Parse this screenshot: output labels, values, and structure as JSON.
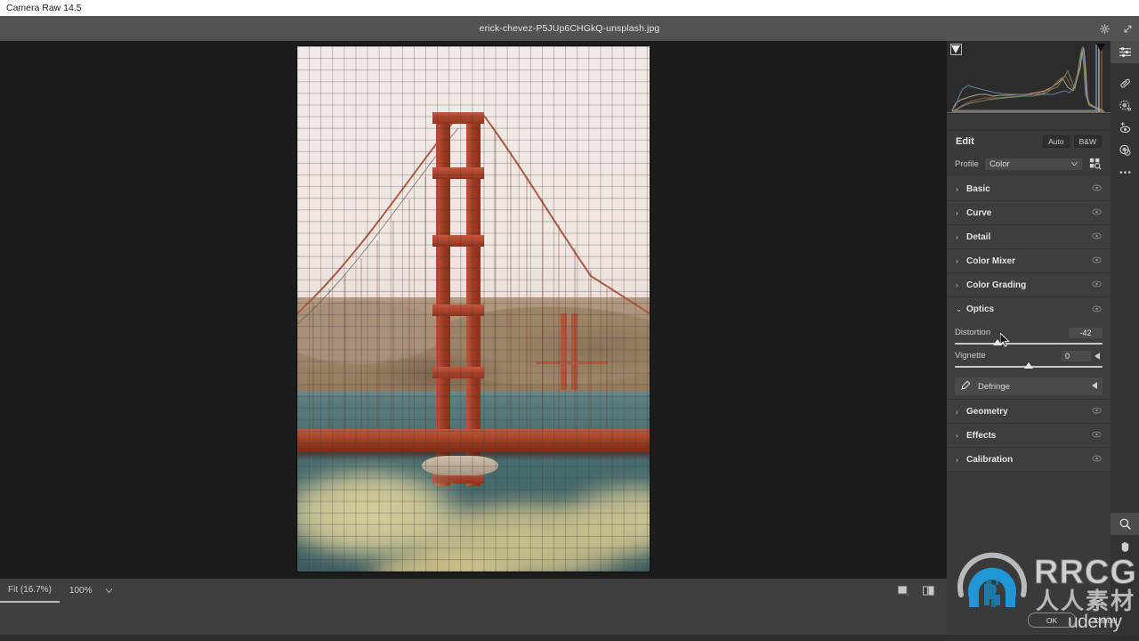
{
  "window": {
    "title": "Camera Raw 14.5"
  },
  "header": {
    "filename": "erick-chevez-P5JUp6CHGkQ-unsplash.jpg",
    "settings_icon": "gear-icon",
    "fullscreen_icon": "expand-icon"
  },
  "canvas": {
    "image_alt": "Golden Gate Bridge",
    "grid_overlay": true
  },
  "statusbar": {
    "fit_label": "Fit (16.7%)",
    "zoom_label": "100%",
    "zoom_caret": "⌄",
    "view_single_icon": "single-view-icon",
    "view_before_after_icon": "before-after-view-icon"
  },
  "panel": {
    "edit": {
      "title": "Edit",
      "auto_label": "Auto",
      "bw_label": "B&W"
    },
    "profile": {
      "label": "Profile",
      "value": "Color",
      "caret": "⌄",
      "browse_icon": "browse-profiles-icon"
    },
    "sections": [
      {
        "name": "Basic",
        "expanded": false,
        "arrow": "›",
        "eye": "eye-icon"
      },
      {
        "name": "Curve",
        "expanded": false,
        "arrow": "›",
        "eye": "eye-icon"
      },
      {
        "name": "Detail",
        "expanded": false,
        "arrow": "›",
        "eye": "eye-icon"
      },
      {
        "name": "Color Mixer",
        "expanded": false,
        "arrow": "›",
        "eye": "eye-icon"
      },
      {
        "name": "Color Grading",
        "expanded": false,
        "arrow": "›",
        "eye": "eye-icon"
      }
    ],
    "optics": {
      "name": "Optics",
      "arrow": "⌄",
      "eye": "eye-icon",
      "sliders": [
        {
          "label": "Distortion",
          "value": "-42",
          "percent": 29
        },
        {
          "label": "Vignette",
          "value": "0",
          "percent": 50
        }
      ],
      "defringe": {
        "label": "Defringe",
        "eyedropper_icon": "defringe-eyedropper-icon",
        "caret": "◀"
      }
    },
    "sections_lower": [
      {
        "name": "Geometry",
        "expanded": false,
        "arrow": "›",
        "eye": "eye-icon"
      },
      {
        "name": "Effects",
        "expanded": false,
        "arrow": "›",
        "eye": "eye-icon"
      },
      {
        "name": "Calibration",
        "expanded": false,
        "arrow": "›",
        "eye": "eye-icon"
      }
    ]
  },
  "histogram": {
    "clip_shadow_icon": "shadow-clipping-indicator",
    "clip_highlight_icon": "highlight-clipping-indicator"
  },
  "tools": {
    "top": [
      {
        "icon": "edit-sliders-icon",
        "selected": true
      },
      {
        "icon": "healing-brush-icon",
        "selected": false
      },
      {
        "icon": "masking-icon",
        "selected": false
      },
      {
        "icon": "red-eye-icon",
        "selected": false
      },
      {
        "icon": "presets-icon",
        "selected": false
      },
      {
        "icon": "more-options-icon",
        "selected": false
      }
    ],
    "bottom": [
      {
        "icon": "zoom-tool-icon",
        "selected": true
      },
      {
        "icon": "hand-tool-icon",
        "selected": false
      }
    ]
  },
  "footer": {
    "ok_label": "OK",
    "cancel_label": "Cancel"
  },
  "watermark": {
    "brand": "RRCG",
    "chinese": "人人素材",
    "udemy": "udemy",
    "logo_icon": "rrcg-logo-icon"
  },
  "colors": {
    "panel_bg": "#3a3a3a",
    "section_bg": "#3e3e3e",
    "canvas_bg": "#1c1c1c",
    "header_bg": "#525252",
    "accent_blue": "#2196d6",
    "slider_track": "#c9c9c9"
  }
}
